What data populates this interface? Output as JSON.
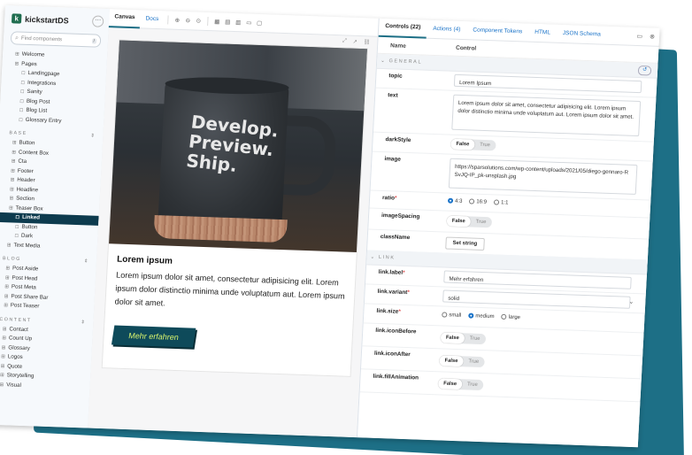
{
  "app": {
    "name": "kickstartDS",
    "menu_icon": "dots-icon"
  },
  "search": {
    "placeholder": "Find components",
    "shortcut": "/"
  },
  "sidebar": {
    "top_items": [
      {
        "label": "Welcome",
        "indent": 0
      },
      {
        "label": "Pages",
        "indent": 0
      },
      {
        "label": "Landingpage",
        "indent": 1
      },
      {
        "label": "Integrations",
        "indent": 1
      },
      {
        "label": "Sanity",
        "indent": 1
      },
      {
        "label": "Blog Post",
        "indent": 1
      },
      {
        "label": "Blog List",
        "indent": 1
      },
      {
        "label": "Glossary Entry",
        "indent": 1
      }
    ],
    "sections": [
      {
        "title": "BASE",
        "items": [
          {
            "label": "Button",
            "indent": 0
          },
          {
            "label": "Content Box",
            "indent": 0
          },
          {
            "label": "Cta",
            "indent": 0
          },
          {
            "label": "Footer",
            "indent": 0
          },
          {
            "label": "Header",
            "indent": 0
          },
          {
            "label": "Headline",
            "indent": 0
          },
          {
            "label": "Section",
            "indent": 0
          },
          {
            "label": "Teaser Box",
            "indent": 0
          },
          {
            "label": "Linked",
            "indent": 1,
            "selected": true
          },
          {
            "label": "Button",
            "indent": 1
          },
          {
            "label": "Dark",
            "indent": 1
          },
          {
            "label": "Text Media",
            "indent": 0
          }
        ]
      },
      {
        "title": "BLOG",
        "items": [
          {
            "label": "Post Aside",
            "indent": 0
          },
          {
            "label": "Post Head",
            "indent": 0
          },
          {
            "label": "Post Meta",
            "indent": 0
          },
          {
            "label": "Post Share Bar",
            "indent": 0
          },
          {
            "label": "Post Teaser",
            "indent": 0
          }
        ]
      },
      {
        "title": "CONTENT",
        "items": [
          {
            "label": "Contact",
            "indent": 0
          },
          {
            "label": "Count Up",
            "indent": 0
          },
          {
            "label": "Glossary",
            "indent": 0
          },
          {
            "label": "Logos",
            "indent": 0
          },
          {
            "label": "Quote",
            "indent": 0
          },
          {
            "label": "Storytelling",
            "indent": 0
          },
          {
            "label": "Visual",
            "indent": 0
          }
        ]
      }
    ]
  },
  "toolbar": {
    "tabs": [
      "Canvas",
      "Docs"
    ],
    "active_tab": "Canvas"
  },
  "preview": {
    "mug_text": "Develop. Preview. Ship.",
    "title": "Lorem ipsum",
    "text": "Lorem ipsum dolor sit amet, consectetur adipisicing elit. Lorem ipsum dolor distinctio minima unde voluptatum aut. Lorem ipsum dolor sit amet.",
    "button_label": "Mehr erfahren"
  },
  "panel": {
    "tabs": [
      "Controls (22)",
      "Actions (4)",
      "Component Tokens",
      "HTML",
      "JSON Schema"
    ],
    "active_tab": "Controls (22)",
    "col_name": "Name",
    "col_control": "Control",
    "section_general": "GENERAL",
    "section_link": "LINK",
    "controls": {
      "topic": {
        "label": "topic",
        "value": "Lorem Ipsum"
      },
      "text": {
        "label": "text",
        "value": "Lorem ipsum dolor sit amet, consectetur adipisicing elit. Lorem ipsum dolor distinctio minima unde voluptatum aut. Lorem ipsum dolor sit amet."
      },
      "darkStyle": {
        "label": "darkStyle",
        "off": "False",
        "on": "True",
        "value": false
      },
      "image": {
        "label": "image",
        "value": "https://sparsolutions.com/wp-content/uploads/2021/05/diego-gennaro-RSvJQ-IP_pk-unsplash.jpg"
      },
      "ratio": {
        "label": "ratio",
        "required": true,
        "options": [
          "4:3",
          "16:9",
          "1:1"
        ],
        "selected": "4:3"
      },
      "imageSpacing": {
        "label": "imageSpacing",
        "off": "False",
        "on": "True",
        "value": false
      },
      "className": {
        "label": "className",
        "button": "Set string"
      },
      "link_label": {
        "label": "link.label",
        "required": true,
        "value": "Mehr erfahren"
      },
      "link_variant": {
        "label": "link.variant",
        "required": true,
        "value": "solid"
      },
      "link_size": {
        "label": "link.size",
        "required": true,
        "options": [
          "small",
          "medium",
          "large"
        ],
        "selected": "medium"
      },
      "link_iconBefore": {
        "label": "link.iconBefore",
        "off": "False",
        "on": "True",
        "value": false
      },
      "link_iconAfter": {
        "label": "link.iconAfter",
        "off": "False",
        "on": "True",
        "value": false
      },
      "link_fillAnimation": {
        "label": "link.fillAnimation",
        "off": "False",
        "on": "True",
        "value": false
      }
    }
  },
  "colors": {
    "brand": "#1d6f86",
    "selected": "#0d3b4e",
    "button_bg": "#0e4a5a",
    "button_text": "#d8f36d",
    "link": "#1a73c8"
  }
}
